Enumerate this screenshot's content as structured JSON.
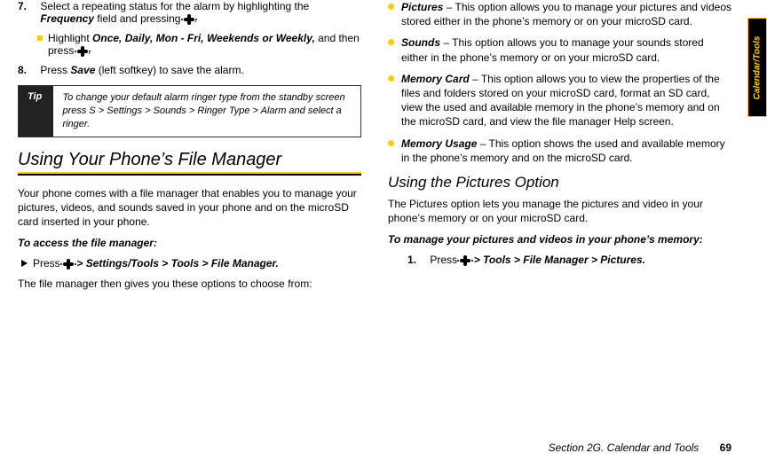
{
  "sideTab": "Calendar/Tools",
  "left": {
    "step7": {
      "num": "7.",
      "text_a": "Select a repeating status for the alarm by highlighting the ",
      "freq": "Frequency",
      "text_b": " field and pressing ",
      "dot": ".",
      "sub_a": "Highlight ",
      "opts": "Once, Daily, Mon - Fri, Weekends or Weekly,",
      "sub_b": " and then press ",
      "sub_dot": "."
    },
    "step8": {
      "num": "8.",
      "text_a": "Press ",
      "save": "Save",
      "text_b": " (left softkey) to save the alarm."
    },
    "tipLabel": "Tip",
    "tipBody": "To change your default alarm ringer type from the standby screen press S > Settings > Sounds > Ringer Type > Alarm  and select a ringer.",
    "h1": "Using Your Phone’s File Manager",
    "para1": "Your phone comes with a file manager that enables you to manage your pictures, videos, and sounds saved in your phone and on the microSD card inserted in your phone.",
    "lead1": "To access the file manager:",
    "press": "Press ",
    "path1": " > Settings/Tools >  Tools > File Manager.",
    "para2": "The file manager then gives you these options to choose from:"
  },
  "right": {
    "f1": {
      "t": "Pictures",
      "b": " – This option allows you to manage your pictures and videos stored either in the phone’s memory or on your microSD card."
    },
    "f2": {
      "t": "Sounds",
      "b": " – This option allows you to manage your sounds stored either in the phone’s memory or on your microSD card."
    },
    "f3": {
      "t": "Memory Card",
      "b": " – This option allows you to view the properties of the files and folders stored on your microSD card, format an SD card, view the used and available memory in the phone’s memory and on the microSD card, and view the file manager Help screen."
    },
    "f4": {
      "t": "Memory Usage",
      "b": " – This option shows the used and available memory in the phone’s memory and on the microSD card."
    },
    "h2": "Using the Pictures Option",
    "para3": "The Pictures option lets you manage the pictures and video in your phone’s memory or on your microSD card.",
    "lead2": "To manage your pictures and videos in your phone’s memory:",
    "step1": {
      "num": "1.",
      "press": "Press ",
      "path": " > Tools > File Manager > Pictures."
    }
  },
  "footer": {
    "section": "Section 2G. Calendar and Tools",
    "page": "69"
  }
}
